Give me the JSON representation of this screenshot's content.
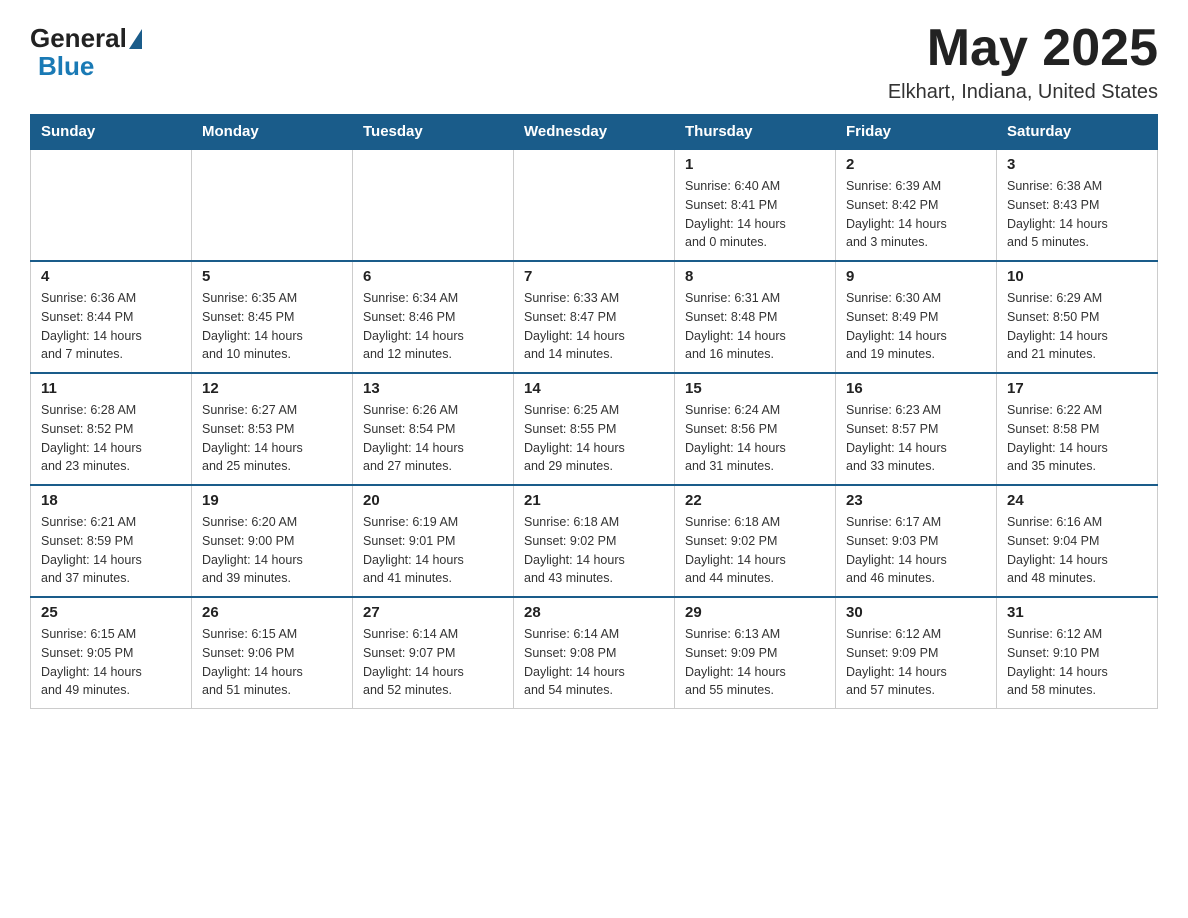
{
  "header": {
    "logo_general": "General",
    "logo_blue": "Blue",
    "month_title": "May 2025",
    "subtitle": "Elkhart, Indiana, United States"
  },
  "days_of_week": [
    "Sunday",
    "Monday",
    "Tuesday",
    "Wednesday",
    "Thursday",
    "Friday",
    "Saturday"
  ],
  "weeks": [
    [
      {
        "day": "",
        "info": ""
      },
      {
        "day": "",
        "info": ""
      },
      {
        "day": "",
        "info": ""
      },
      {
        "day": "",
        "info": ""
      },
      {
        "day": "1",
        "info": "Sunrise: 6:40 AM\nSunset: 8:41 PM\nDaylight: 14 hours\nand 0 minutes."
      },
      {
        "day": "2",
        "info": "Sunrise: 6:39 AM\nSunset: 8:42 PM\nDaylight: 14 hours\nand 3 minutes."
      },
      {
        "day": "3",
        "info": "Sunrise: 6:38 AM\nSunset: 8:43 PM\nDaylight: 14 hours\nand 5 minutes."
      }
    ],
    [
      {
        "day": "4",
        "info": "Sunrise: 6:36 AM\nSunset: 8:44 PM\nDaylight: 14 hours\nand 7 minutes."
      },
      {
        "day": "5",
        "info": "Sunrise: 6:35 AM\nSunset: 8:45 PM\nDaylight: 14 hours\nand 10 minutes."
      },
      {
        "day": "6",
        "info": "Sunrise: 6:34 AM\nSunset: 8:46 PM\nDaylight: 14 hours\nand 12 minutes."
      },
      {
        "day": "7",
        "info": "Sunrise: 6:33 AM\nSunset: 8:47 PM\nDaylight: 14 hours\nand 14 minutes."
      },
      {
        "day": "8",
        "info": "Sunrise: 6:31 AM\nSunset: 8:48 PM\nDaylight: 14 hours\nand 16 minutes."
      },
      {
        "day": "9",
        "info": "Sunrise: 6:30 AM\nSunset: 8:49 PM\nDaylight: 14 hours\nand 19 minutes."
      },
      {
        "day": "10",
        "info": "Sunrise: 6:29 AM\nSunset: 8:50 PM\nDaylight: 14 hours\nand 21 minutes."
      }
    ],
    [
      {
        "day": "11",
        "info": "Sunrise: 6:28 AM\nSunset: 8:52 PM\nDaylight: 14 hours\nand 23 minutes."
      },
      {
        "day": "12",
        "info": "Sunrise: 6:27 AM\nSunset: 8:53 PM\nDaylight: 14 hours\nand 25 minutes."
      },
      {
        "day": "13",
        "info": "Sunrise: 6:26 AM\nSunset: 8:54 PM\nDaylight: 14 hours\nand 27 minutes."
      },
      {
        "day": "14",
        "info": "Sunrise: 6:25 AM\nSunset: 8:55 PM\nDaylight: 14 hours\nand 29 minutes."
      },
      {
        "day": "15",
        "info": "Sunrise: 6:24 AM\nSunset: 8:56 PM\nDaylight: 14 hours\nand 31 minutes."
      },
      {
        "day": "16",
        "info": "Sunrise: 6:23 AM\nSunset: 8:57 PM\nDaylight: 14 hours\nand 33 minutes."
      },
      {
        "day": "17",
        "info": "Sunrise: 6:22 AM\nSunset: 8:58 PM\nDaylight: 14 hours\nand 35 minutes."
      }
    ],
    [
      {
        "day": "18",
        "info": "Sunrise: 6:21 AM\nSunset: 8:59 PM\nDaylight: 14 hours\nand 37 minutes."
      },
      {
        "day": "19",
        "info": "Sunrise: 6:20 AM\nSunset: 9:00 PM\nDaylight: 14 hours\nand 39 minutes."
      },
      {
        "day": "20",
        "info": "Sunrise: 6:19 AM\nSunset: 9:01 PM\nDaylight: 14 hours\nand 41 minutes."
      },
      {
        "day": "21",
        "info": "Sunrise: 6:18 AM\nSunset: 9:02 PM\nDaylight: 14 hours\nand 43 minutes."
      },
      {
        "day": "22",
        "info": "Sunrise: 6:18 AM\nSunset: 9:02 PM\nDaylight: 14 hours\nand 44 minutes."
      },
      {
        "day": "23",
        "info": "Sunrise: 6:17 AM\nSunset: 9:03 PM\nDaylight: 14 hours\nand 46 minutes."
      },
      {
        "day": "24",
        "info": "Sunrise: 6:16 AM\nSunset: 9:04 PM\nDaylight: 14 hours\nand 48 minutes."
      }
    ],
    [
      {
        "day": "25",
        "info": "Sunrise: 6:15 AM\nSunset: 9:05 PM\nDaylight: 14 hours\nand 49 minutes."
      },
      {
        "day": "26",
        "info": "Sunrise: 6:15 AM\nSunset: 9:06 PM\nDaylight: 14 hours\nand 51 minutes."
      },
      {
        "day": "27",
        "info": "Sunrise: 6:14 AM\nSunset: 9:07 PM\nDaylight: 14 hours\nand 52 minutes."
      },
      {
        "day": "28",
        "info": "Sunrise: 6:14 AM\nSunset: 9:08 PM\nDaylight: 14 hours\nand 54 minutes."
      },
      {
        "day": "29",
        "info": "Sunrise: 6:13 AM\nSunset: 9:09 PM\nDaylight: 14 hours\nand 55 minutes."
      },
      {
        "day": "30",
        "info": "Sunrise: 6:12 AM\nSunset: 9:09 PM\nDaylight: 14 hours\nand 57 minutes."
      },
      {
        "day": "31",
        "info": "Sunrise: 6:12 AM\nSunset: 9:10 PM\nDaylight: 14 hours\nand 58 minutes."
      }
    ]
  ]
}
